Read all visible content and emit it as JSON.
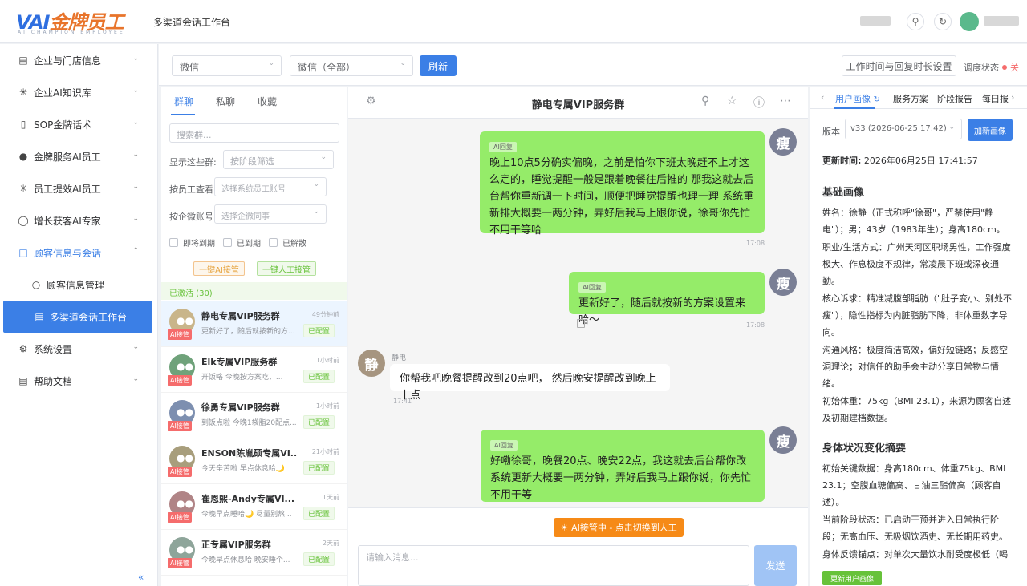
{
  "header": {
    "logo_ai": "VAI",
    "logo_cn": "金牌员工",
    "logo_sub": "AI CHAMPION EMPLOYEE",
    "title": "多渠道会话工作台"
  },
  "sidebar": {
    "items": [
      {
        "label": "企业与门店信息"
      },
      {
        "label": "企业AI知识库"
      },
      {
        "label": "SOP金牌话术"
      },
      {
        "label": "金牌服务AI员工"
      },
      {
        "label": "员工提效AI员工"
      },
      {
        "label": "增长获客AI专家"
      },
      {
        "label": "顾客信息与会话"
      },
      {
        "label": "顾客信息管理"
      },
      {
        "label": "多渠道会话工作台"
      },
      {
        "label": "系统设置"
      },
      {
        "label": "帮助文档"
      }
    ],
    "collapse": "«"
  },
  "toolbar": {
    "channel_select": "微信",
    "account_select": "微信（全部）",
    "refresh": "刷新",
    "work_time_btn": "工作时间与回复时长设置",
    "schedule_label": "调度状态",
    "schedule_value": "关"
  },
  "left_panel": {
    "tabs": [
      "群聊",
      "私聊",
      "收藏"
    ],
    "search_placeholder": "搜索群...",
    "show_groups_label": "显示这些群:",
    "stage_filter_placeholder": "按阶段筛选",
    "by_employee_label": "按员工查看",
    "employee_placeholder": "选择系统员工账号",
    "by_wecom_label": "按企微账号",
    "wecom_placeholder": "选择企微同事",
    "checkboxes": [
      "即将到期",
      "已到期",
      "已解散"
    ],
    "ai_takeover_btn": "一键AI接管",
    "manual_takeover_btn": "一键人工接管",
    "active_count": "已激活 (30)",
    "groups": [
      {
        "name": "静电专属VIP服务群",
        "time": "49分钟前",
        "preview": "更新好了，随后就按新的方...",
        "badge": "AI接管",
        "config": "已配置",
        "color": "#c9b58a"
      },
      {
        "name": "Elk专属VIP服务群",
        "time": "1小时前",
        "preview": "开饭咯 今晚按方案吃，...",
        "badge": "AI接管",
        "config": "已配置",
        "color": "#6fa27a"
      },
      {
        "name": "徐勇专属VIP服务群",
        "time": "1小时前",
        "preview": "到饭点啦 今晚1袋脂20配点...",
        "badge": "AI接管",
        "config": "已配置",
        "color": "#7d8fb0"
      },
      {
        "name": "ENSON陈胤硕专属VI...",
        "time": "21小时前",
        "preview": "今天辛苦啦 早点休息哈🌙",
        "badge": "AI接管",
        "config": "已配置",
        "color": "#a89e7c"
      },
      {
        "name": "崔恩熙-Andy专属VI...",
        "time": "1天前",
        "preview": "今晚早点睡哈🌙 尽量别熬...",
        "badge": "AI接管",
        "config": "已配置",
        "color": "#b08486"
      },
      {
        "name": "正专属VIP服务群",
        "time": "2天前",
        "preview": "今晚早点休息哈 晚安睡个...",
        "badge": "AI接管",
        "config": "已配置",
        "color": "#8ea59a"
      }
    ]
  },
  "chat": {
    "title": "静电专属VIP服务群",
    "messages": [
      {
        "tag": "AI回复",
        "text": "晚上10点5分确实偏晚，之前是怕你下班太晚赶不上才这么定的，睡觉提醒一般是跟着晚餐往后推的 那我这就去后台帮你重新调一下时间，顺便把睡觉提醒也理一理 系统重新排大概要一两分钟，弄好后我马上跟你说，徐哥你先忙不用干等哈",
        "time": "17:08",
        "avatar": "瘦"
      },
      {
        "tag": "AI回复",
        "text": "更新好了，随后就按新的方案设置来哈～",
        "time": "17:08",
        "avatar": "瘦"
      },
      {
        "sender": "静电",
        "text": "你帮我吧晚餐提醒改到20点吧， 然后晚安提醒改到晚上十点",
        "time": "17:41",
        "avatar": "静"
      },
      {
        "tag": "AI回复",
        "text": "好嘞徐哥，晚餐20点、晚安22点，我这就去后台帮你改 系统更新大概要一两分钟，弄好后我马上跟你说，你先忙不用干等",
        "avatar": "瘦"
      }
    ],
    "ai_status_btn": "AI接管中 - 点击切换到人工",
    "input_placeholder": "请输入消息...",
    "send": "发送"
  },
  "right_panel": {
    "tabs": [
      "用户画像",
      "服务方案",
      "阶段报告",
      "每日报"
    ],
    "version_label": "版本",
    "version_value": "v33 (2026-06-25 17:42)",
    "add_profile_btn": "加新画像",
    "update_time_label": "更新时间:",
    "update_time_value": "2026年06月25日 17:41:57",
    "basic_title": "基础画像",
    "basic_lines": [
      "姓名：徐静（正式称呼\"徐哥\"，严禁使用\"静电\"）；男；43岁（1983年生）；身高180cm。",
      "职业/生活方式：广州天河区职场男性，工作强度极大、作息极度不规律，常凌晨下班或深夜通勤。",
      "核心诉求：精准减腹部脂肪（\"肚子变小、别处不瘦\"），隐性指标为内脏脂肪下降，非体重数字导向。",
      "沟通风格：极度简洁高效，偏好短链路；反感空洞理论；对信任的助手会主动分享日常物与情绪。",
      "初始体重：75kg（BMI 23.1），来源为顾客自述及初期建档数据。"
    ],
    "body_title": "身体状况变化摘要",
    "body_lines": [
      "初始关键数据：身高180cm、体重75kg、BMI 23.1；空腹血糖偏高、甘油三酯偏高（顾客自述）。",
      "当前阶段状态：已启动干预并进入日常执行阶段；无高血压、无吸烟饮酒史、无长期用药史。",
      "身体反馈锚点：对单次大量饮水耐受度极低（喝"
    ],
    "update_btn": "更新用户画像"
  }
}
